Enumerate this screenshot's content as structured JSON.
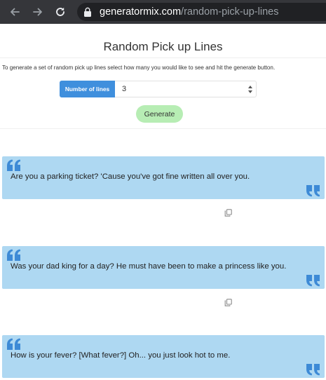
{
  "browser": {
    "url_host": "generatormix.com",
    "url_path": "/random-pick-up-lines",
    "icons": [
      "back-arrow-icon",
      "forward-arrow-icon",
      "reload-icon",
      "lock-icon"
    ]
  },
  "page": {
    "title": "Random Pick up Lines",
    "intro": "To generate a set of random pick up lines select how many you would like to see and hit the generate button."
  },
  "form": {
    "number_label": "Number of lines",
    "number_value": "3",
    "generate_label": "Generate"
  },
  "results": [
    {
      "text": "Are you a parking ticket? 'Cause you've got fine written all over you."
    },
    {
      "text": "Was your dad king for a day? He must have been to make a princess like you."
    },
    {
      "text": "How is your fever? [What fever?] Oh... you just look hot to me."
    }
  ],
  "colors": {
    "chrome_bg": "#35363a",
    "omnibox_bg": "#202124",
    "addon_blue": "#3f8fdd",
    "generate_green": "#b7edb4",
    "card_blue": "#aed8f2",
    "quote_blue": "#3d8ad6"
  }
}
